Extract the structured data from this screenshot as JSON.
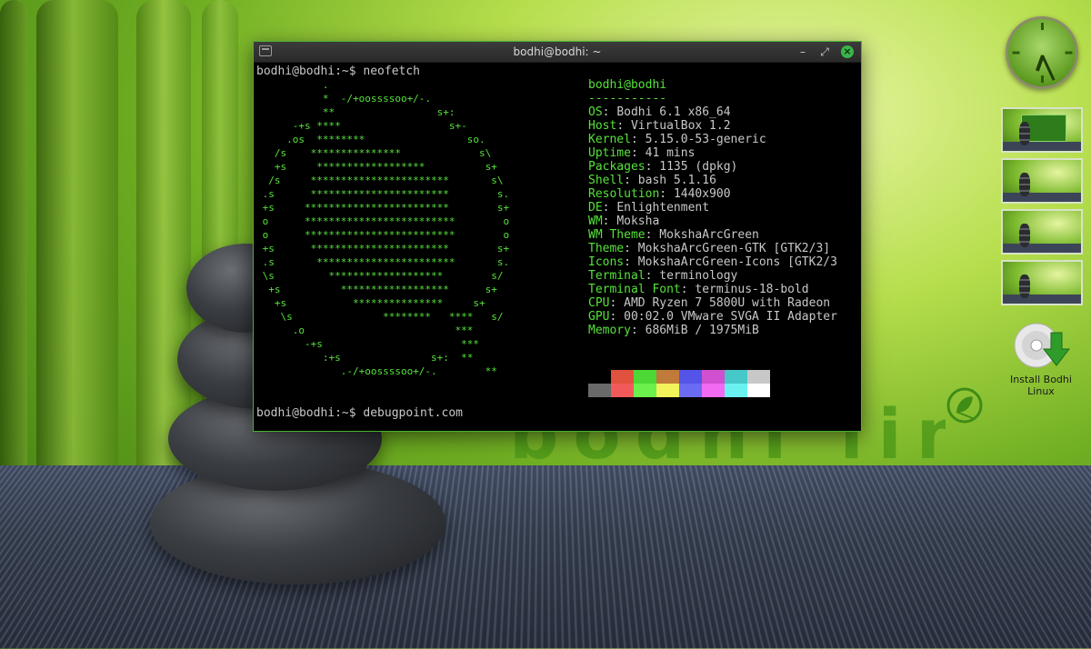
{
  "wallpaper": {
    "brand_text": "bodhi linux"
  },
  "terminal": {
    "title": "bodhi@bodhi: ~",
    "minimize_glyph": "–",
    "maximize_glyph": "⤢",
    "close_glyph": "×",
    "prompt_1": "bodhi@bodhi:~$ neofetch",
    "prompt_2": "bodhi@bodhi:~$ debugpoint.com",
    "ascii_logo": "           .\n           *  -/+oossssoo+/-.\n           **                 s+:\n      -+s ****                  s+-\n     .os  ********                 so.\n   /s    ***************             s\\\n   +s     ******************          s+\n  /s     ***********************       s\\\n .s      ***********************        s.\n +s     ************************        s+\n o      *************************        o\n o      *************************        o\n +s      ***********************        s+\n .s       ***********************       s.\n \\s         *******************        s/\n  +s          ******************      s+\n   +s           ***************     s+\n    \\s               ********   ****   s/\n      .o                         ***\n        -+s                       ***\n           :+s               s+:  **\n              .-/+oossssoo+/-.        **",
    "user_host": "bodhi@bodhi",
    "separator": "-----------",
    "info": [
      {
        "key": "OS",
        "value": "Bodhi 6.1 x86_64"
      },
      {
        "key": "Host",
        "value": "VirtualBox 1.2"
      },
      {
        "key": "Kernel",
        "value": "5.15.0-53-generic"
      },
      {
        "key": "Uptime",
        "value": "41 mins"
      },
      {
        "key": "Packages",
        "value": "1135 (dpkg)"
      },
      {
        "key": "Shell",
        "value": "bash 5.1.16"
      },
      {
        "key": "Resolution",
        "value": "1440x900"
      },
      {
        "key": "DE",
        "value": "Enlightenment"
      },
      {
        "key": "WM",
        "value": "Moksha"
      },
      {
        "key": "WM Theme",
        "value": "MokshaArcGreen"
      },
      {
        "key": "Theme",
        "value": "MokshaArcGreen-GTK [GTK2/3]"
      },
      {
        "key": "Icons",
        "value": "MokshaArcGreen-Icons [GTK2/3"
      },
      {
        "key": "Terminal",
        "value": "terminology"
      },
      {
        "key": "Terminal Font",
        "value": "terminus-18-bold"
      },
      {
        "key": "CPU",
        "value": "AMD Ryzen 7 5800U with Radeon"
      },
      {
        "key": "GPU",
        "value": "00:02.0 VMware SVGA II Adapter"
      },
      {
        "key": "Memory",
        "value": "686MiB / 1975MiB"
      }
    ],
    "palette": {
      "dark": [
        "#000000",
        "#e0523e",
        "#4ed836",
        "#c07a3a",
        "#5454e8",
        "#d050d0",
        "#46c8c8",
        "#c8c8c8"
      ],
      "light": [
        "#6a6a6a",
        "#f25a5a",
        "#6cf04c",
        "#f2f25a",
        "#6a6af2",
        "#f26af2",
        "#6af2f2",
        "#ffffff"
      ]
    },
    "accent_color": "#56e23a"
  },
  "desktop": {
    "clock_icon": "clock-icon",
    "workspaces": [
      {
        "name": "workspace-1",
        "active": true
      },
      {
        "name": "workspace-2",
        "active": false
      },
      {
        "name": "workspace-3",
        "active": false
      },
      {
        "name": "workspace-4",
        "active": false
      }
    ],
    "install_icon": "install-disc-icon",
    "install_label": "Install Bodhi Linux"
  }
}
